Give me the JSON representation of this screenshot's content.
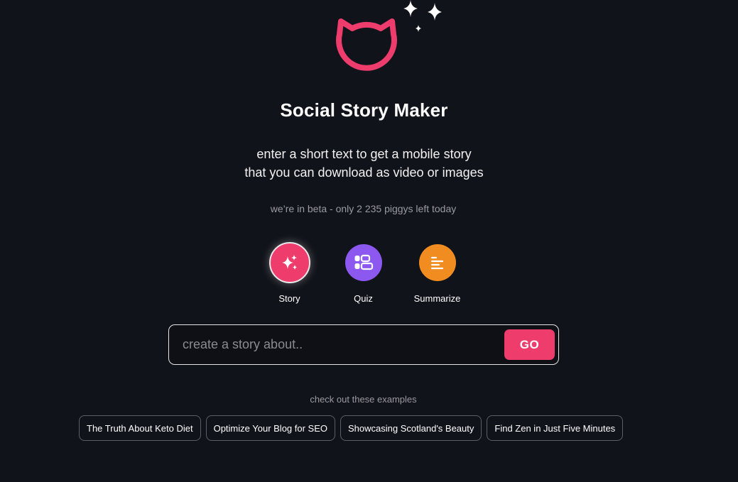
{
  "app": {
    "title": "Social Story Maker",
    "subtitle_line1": "enter a short text to get a mobile story",
    "subtitle_line2": "that you can download as video or images",
    "beta_notice": "we’re in beta - only 2 235 piggys left today"
  },
  "logo": {
    "icon": "cat-head-icon",
    "sparkles": "sparkles-icon",
    "color": "#ee3d6d"
  },
  "modes": [
    {
      "label": "Story",
      "icon": "sparkles-icon",
      "color": "#ee3d6d",
      "selected": true
    },
    {
      "label": "Quiz",
      "icon": "quiz-layout-icon",
      "color": "#8c58f0",
      "selected": false
    },
    {
      "label": "Summarize",
      "icon": "summarize-lines-icon",
      "color": "#f08c20",
      "selected": false
    }
  ],
  "search": {
    "placeholder": "create a story about..",
    "value": "",
    "button_label": "GO"
  },
  "examples": {
    "label": "check out these examples",
    "items": [
      "The Truth About Keto Diet",
      "Optimize Your Blog for SEO",
      "Showcasing Scotland's Beauty",
      "Find Zen in Just Five Minutes"
    ]
  }
}
